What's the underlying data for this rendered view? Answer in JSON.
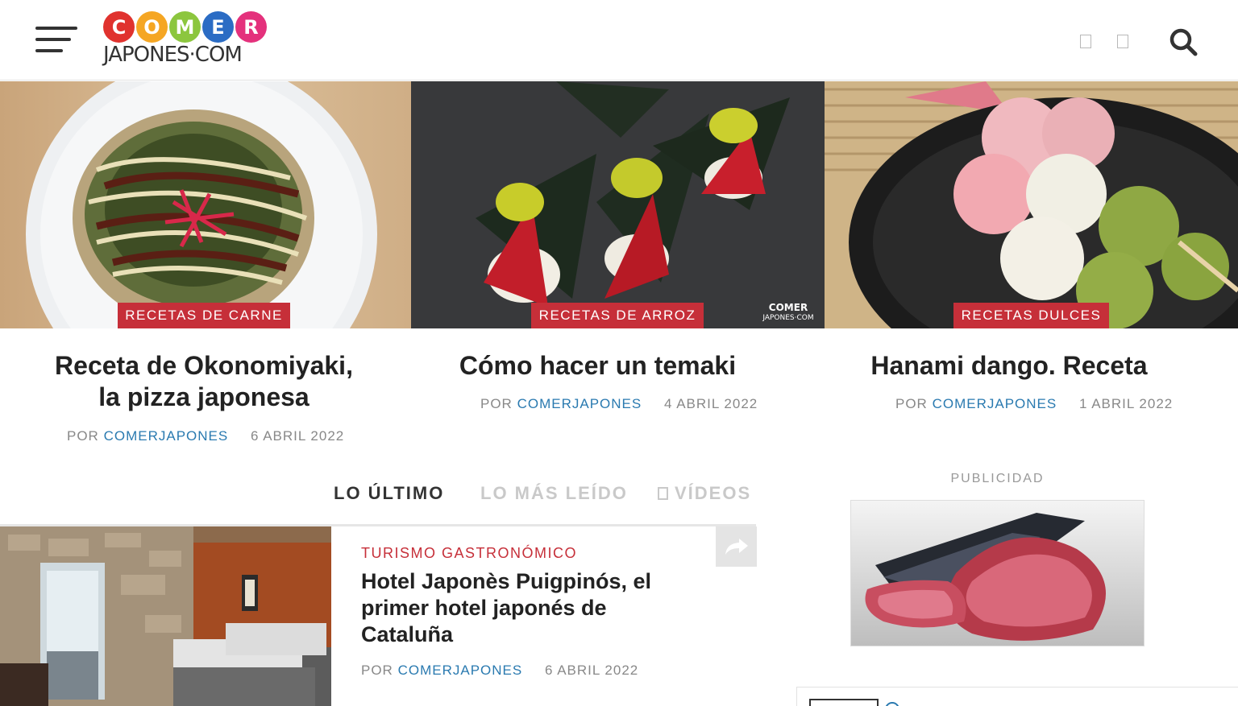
{
  "header": {
    "logo": {
      "letters": [
        "C",
        "O",
        "M",
        "E",
        "R"
      ],
      "letter_colors": [
        "#e0322e",
        "#f5a623",
        "#8cc63e",
        "#2b6cc4",
        "#e4317c"
      ],
      "subtitle": "JAPONES·COM"
    },
    "icons": [
      "hamburger-icon",
      "search-icon"
    ]
  },
  "featured": [
    {
      "category": "RECETAS DE CARNE",
      "title_line1": "Receta de Okonomiyaki,",
      "title_line2": "la pizza japonesa",
      "by": "POR",
      "author": "COMERJAPONES",
      "date": "6 ABRIL 2022"
    },
    {
      "category": "RECETAS DE ARROZ",
      "title_line1": "Cómo hacer un temaki",
      "by": "POR",
      "author": "COMERJAPONES",
      "date": "4 ABRIL 2022",
      "watermark_top": "COMER",
      "watermark_bottom": "JAPONES·COM"
    },
    {
      "category": "RECETAS DULCES",
      "title_line1": "Hanami dango. Receta",
      "by": "POR",
      "author": "COMERJAPONES",
      "date": "1 ABRIL 2022"
    }
  ],
  "tabs": [
    {
      "label": "LO ÚLTIMO",
      "active": true
    },
    {
      "label": "LO MÁS LEÍDO",
      "active": false
    },
    {
      "label": "VÍDEOS",
      "active": false
    }
  ],
  "latest_article": {
    "category": "TURISMO GASTRONÓMICO",
    "title": "Hotel Japonès Puigpinós, el primer hotel japonés de Cataluña",
    "by": "POR",
    "author": "COMERJAPONES",
    "date": "6 ABRIL 2022"
  },
  "sidebar": {
    "ad_label": "PUBLICIDAD"
  },
  "colors": {
    "accent_red": "#c62f39",
    "link_blue": "#2a7ab0",
    "meta_gray": "#888888"
  }
}
